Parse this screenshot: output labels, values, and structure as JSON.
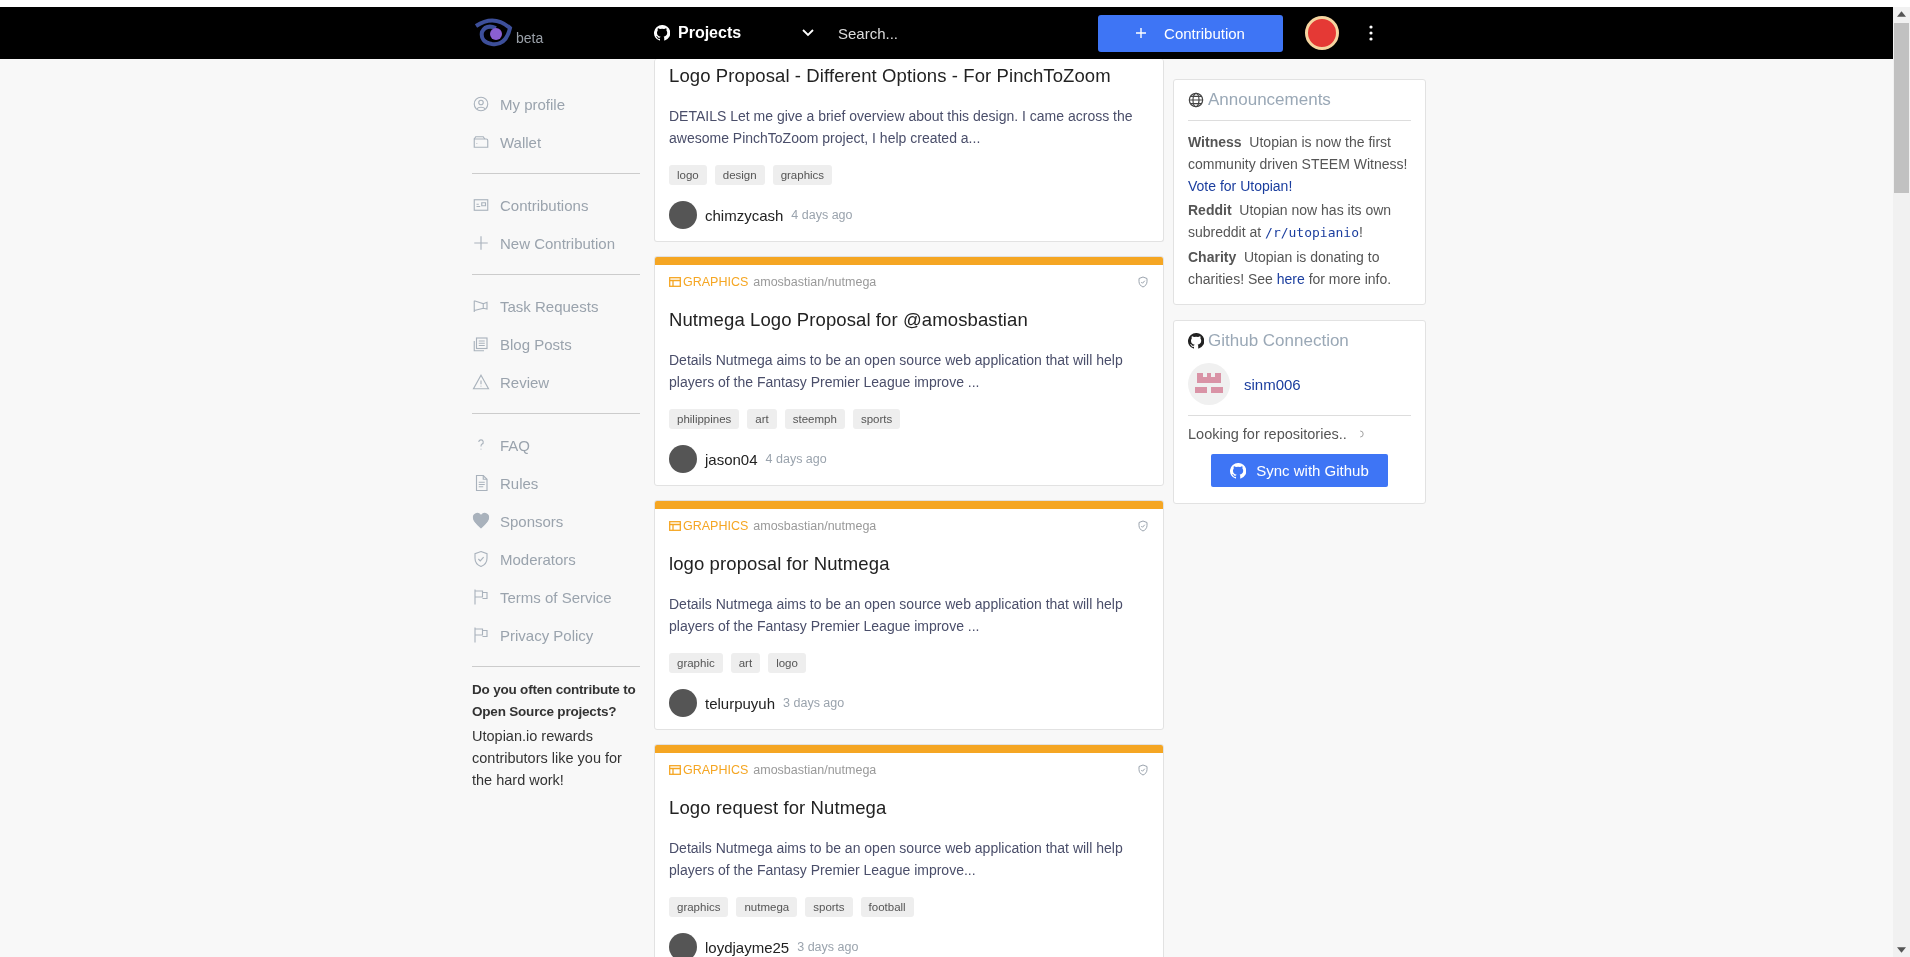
{
  "header": {
    "logo_badge": "beta",
    "projects_label": "Projects",
    "search": {
      "placeholder": "Search..."
    },
    "contribution_button": "Contribution"
  },
  "sidebar": {
    "groups": [
      {
        "items": [
          {
            "label": "My profile"
          },
          {
            "label": "Wallet"
          }
        ]
      },
      {
        "items": [
          {
            "label": "Contributions"
          },
          {
            "label": "New Contribution"
          }
        ]
      },
      {
        "items": [
          {
            "label": "Task Requests"
          },
          {
            "label": "Blog Posts"
          },
          {
            "label": "Review"
          }
        ]
      },
      {
        "items": [
          {
            "label": "FAQ"
          },
          {
            "label": "Rules"
          },
          {
            "label": "Sponsors"
          },
          {
            "label": "Moderators"
          },
          {
            "label": "Terms of Service"
          },
          {
            "label": "Privacy Policy"
          }
        ]
      }
    ],
    "promo": {
      "heading": "Do you often contribute to Open Source projects?",
      "text": "Utopian.io rewards contributors like you for the hard work!"
    }
  },
  "cards": [
    {
      "title": "Logo Proposal - Different Options - For PinchToZoom",
      "body": "DETAILS Let me give a brief overview about this design. I came across the awesome PinchToZoom project, I help created a...",
      "tags": [
        "logo",
        "design",
        "graphics"
      ],
      "author": "chimzycash",
      "time": "4 days ago"
    },
    {
      "category": "GRAPHICS",
      "repo": "amosbastian/nutmega",
      "title": "Nutmega Logo Proposal for @amosbastian",
      "body": "Details Nutmega aims to be an open source web application that will help players of the Fantasy Premier League improve ...",
      "tags": [
        "philippines",
        "art",
        "steemph",
        "sports"
      ],
      "author": "jason04",
      "time": "4 days ago"
    },
    {
      "category": "GRAPHICS",
      "repo": "amosbastian/nutmega",
      "title": "logo proposal for Nutmega",
      "body": "Details Nutmega aims to be an open source web application that will help players of the Fantasy Premier League improve ...",
      "tags": [
        "graphic",
        "art",
        "logo"
      ],
      "author": "telurpuyuh",
      "time": "3 days ago"
    },
    {
      "category": "GRAPHICS",
      "repo": "amosbastian/nutmega",
      "title": "Logo request for Nutmega",
      "body": "Details Nutmega aims to be an open source web application that will help players of the Fantasy Premier League improve...",
      "tags": [
        "graphics",
        "nutmega",
        "sports",
        "football"
      ],
      "author": "loydjayme25",
      "time": "3 days ago"
    }
  ],
  "announcements": {
    "title": "Announcements",
    "items": [
      {
        "kind": "plain",
        "label": "Witness",
        "text": "Utopian is now the first community driven STEEM Witness!",
        "link": "Vote for Utopian!"
      },
      {
        "kind": "code",
        "label": "Reddit",
        "text": "Utopian now has its own subreddit at",
        "link": "/r/utopianio",
        "after": "!"
      },
      {
        "kind": "plain",
        "label": "Charity",
        "text": "Utopian is donating to charities! See",
        "link": "here",
        "after": "for more info."
      }
    ]
  },
  "github": {
    "title": "Github Connection",
    "user": "sinm006",
    "status": "Looking for repositories..",
    "button": "Sync with Github"
  }
}
